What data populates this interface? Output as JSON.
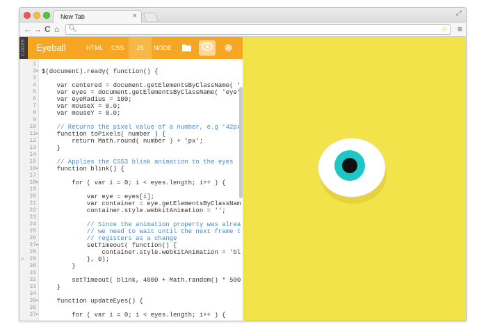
{
  "browser": {
    "tab_title": "New Tab",
    "tab_close": "×",
    "resize_icon": "⤢",
    "nav": {
      "back": "←",
      "forward": "→",
      "reload": "C",
      "home": "⌂"
    },
    "omnibox_search": "🔍︎",
    "star": "☆",
    "menu": "≡"
  },
  "app": {
    "side_label": "CODER",
    "title": "Eyeball",
    "tabs": [
      "HTML",
      "CSS",
      "JS",
      "NODE"
    ],
    "active_tab": "JS",
    "icons": [
      "folder-icon",
      "eye-icon",
      "gear-icon"
    ]
  },
  "code_lines": [
    {
      "n": "1",
      "fold": "",
      "warn": "",
      "text": ""
    },
    {
      "n": "2",
      "fold": "▾",
      "warn": "",
      "text": "$(document).ready( function() {"
    },
    {
      "n": "3",
      "fold": "",
      "warn": "",
      "text": ""
    },
    {
      "n": "4",
      "fold": "",
      "warn": "",
      "text": "    var centered = document.getElementsByClassName( '"
    },
    {
      "n": "5",
      "fold": "",
      "warn": "",
      "text": "    var eyes = document.getElementsByClassName( 'eye'"
    },
    {
      "n": "6",
      "fold": "",
      "warn": "",
      "text": "    var eyeRadius = 100;"
    },
    {
      "n": "7",
      "fold": "",
      "warn": "",
      "text": "    var mouseX = 0.0;"
    },
    {
      "n": "8",
      "fold": "",
      "warn": "",
      "text": "    var mouseY = 0.0;"
    },
    {
      "n": "9",
      "fold": "",
      "warn": "",
      "text": ""
    },
    {
      "n": "10",
      "fold": "",
      "warn": "",
      "text": "    // Returns the pixel value of a number, e.g '42px"
    },
    {
      "n": "11",
      "fold": "▾",
      "warn": "",
      "text": "    function toPixels( number ) {"
    },
    {
      "n": "12",
      "fold": "",
      "warn": "",
      "text": "        return Math.round( number ) + 'px';"
    },
    {
      "n": "13",
      "fold": "",
      "warn": "",
      "text": "    }"
    },
    {
      "n": "14",
      "fold": "",
      "warn": "",
      "text": ""
    },
    {
      "n": "15",
      "fold": "",
      "warn": "",
      "text": "    // Applies the CSS3 blink animation to the eyes"
    },
    {
      "n": "16",
      "fold": "▾",
      "warn": "",
      "text": "    function blink() {"
    },
    {
      "n": "17",
      "fold": "",
      "warn": "",
      "text": ""
    },
    {
      "n": "18",
      "fold": "▾",
      "warn": "",
      "text": "        for ( var i = 0; i < eyes.length; i++ ) {"
    },
    {
      "n": "19",
      "fold": "",
      "warn": "",
      "text": ""
    },
    {
      "n": "20",
      "fold": "",
      "warn": "",
      "text": "            var eye = eyes[i];"
    },
    {
      "n": "21",
      "fold": "",
      "warn": "",
      "text": "            var container = eye.getElementsByClassNam"
    },
    {
      "n": "22",
      "fold": "",
      "warn": "",
      "text": "            container.style.webkitAnimation = '';"
    },
    {
      "n": "23",
      "fold": "",
      "warn": "",
      "text": ""
    },
    {
      "n": "24",
      "fold": "",
      "warn": "",
      "text": "            // Since the animation property was alrea"
    },
    {
      "n": "25",
      "fold": "",
      "warn": "",
      "text": "            // we need to wait until the next frame t"
    },
    {
      "n": "26",
      "fold": "",
      "warn": "",
      "text": "            // registers as a change"
    },
    {
      "n": "27",
      "fold": "▾",
      "warn": "",
      "text": "            setTimeout( function() {"
    },
    {
      "n": "28",
      "fold": "",
      "warn": "",
      "text": "                container.style.webkitAnimation = 'bl"
    },
    {
      "n": "29",
      "fold": "",
      "warn": "⚠",
      "text": "            }, 0);"
    },
    {
      "n": "30",
      "fold": "",
      "warn": "",
      "text": "        }"
    },
    {
      "n": "31",
      "fold": "",
      "warn": "",
      "text": ""
    },
    {
      "n": "32",
      "fold": "",
      "warn": "",
      "text": "        setTimeout( blink, 4000 + Math.random() * 500"
    },
    {
      "n": "33",
      "fold": "",
      "warn": "",
      "text": "    }"
    },
    {
      "n": "34",
      "fold": "",
      "warn": "",
      "text": ""
    },
    {
      "n": "35",
      "fold": "▾",
      "warn": "",
      "text": "    function updateEyes() {"
    },
    {
      "n": "36",
      "fold": "",
      "warn": "",
      "text": ""
    },
    {
      "n": "37",
      "fold": "▾",
      "warn": "",
      "text": "        for ( var i = 0; i < eyes.length; i++ ) {"
    }
  ],
  "colors": {
    "appbar": "#f5a623",
    "preview_bg": "#f3e34b",
    "iris": "#1ec6c6",
    "pupil": "#111111"
  }
}
